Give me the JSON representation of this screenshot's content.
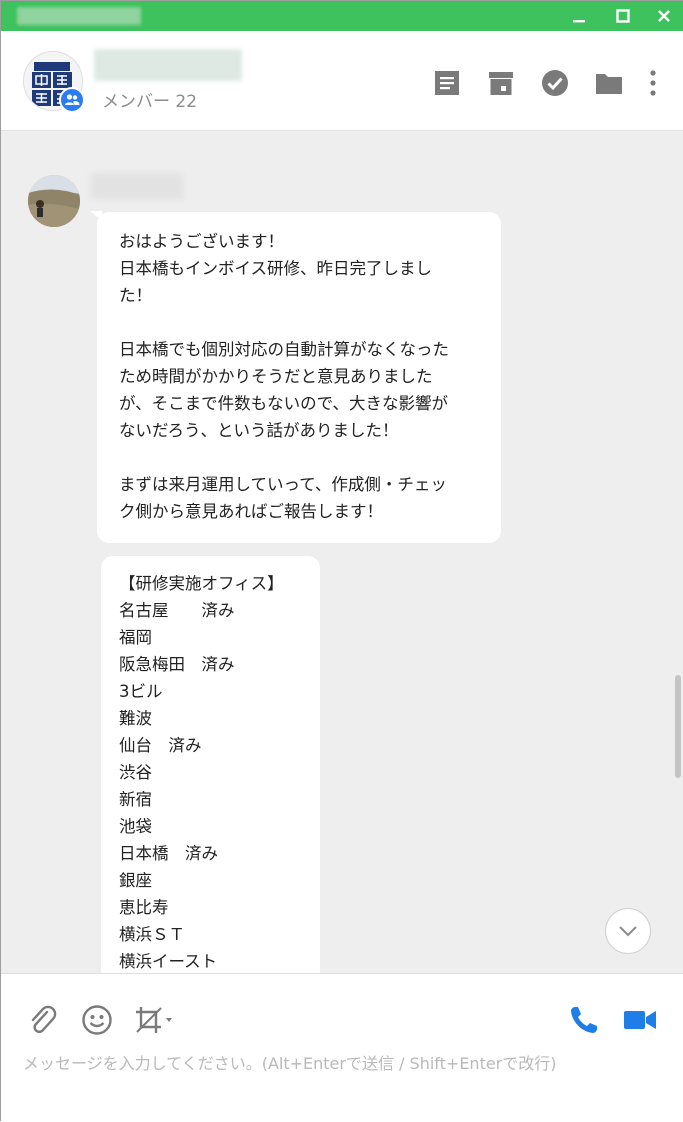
{
  "header": {
    "member_count": "メンバー 22"
  },
  "messages": [
    {
      "text": "おはようございます！\n日本橋もインボイス研修、昨日完了しまし\nた！\n\n日本橋でも個別対応の自動計算がなくなった\nため時間がかかりそうだと意見ありました\nが、そこまで件数もないので、大きな影響が\nないだろう、という話がありました！\n\nまずは来月運用していって、作成側・チェッ\nク側から意見あればご報告します！"
    },
    {
      "text": "【研修実施オフィス】\n名古屋　　済み\n福岡\n阪急梅田　済み\n3ビル\n難波\n仙台　済み\n渋谷\n新宿\n池袋\n日本橋　済み\n銀座\n恵比寿\n横浜ＳＴ\n横浜イースト"
    }
  ],
  "composer": {
    "placeholder": "メッセージを入力してください。(Alt+Enterで送信 / Shift+Enterで改行)"
  },
  "icons": {
    "header": [
      "notes-icon",
      "archive-icon",
      "task-check-icon",
      "folder-icon",
      "more-vertical-icon"
    ],
    "composer": [
      "attach-clip-icon",
      "emoji-icon",
      "crop-capture-icon",
      "phone-call-icon",
      "video-call-icon"
    ],
    "window": [
      "minimize-icon",
      "maximize-icon",
      "close-icon"
    ]
  },
  "colors": {
    "titlebar": "#3ec25e",
    "accent_blue": "#1f7de8",
    "icon_gray": "#7a7a7a",
    "chat_bg": "#eeeeee"
  }
}
